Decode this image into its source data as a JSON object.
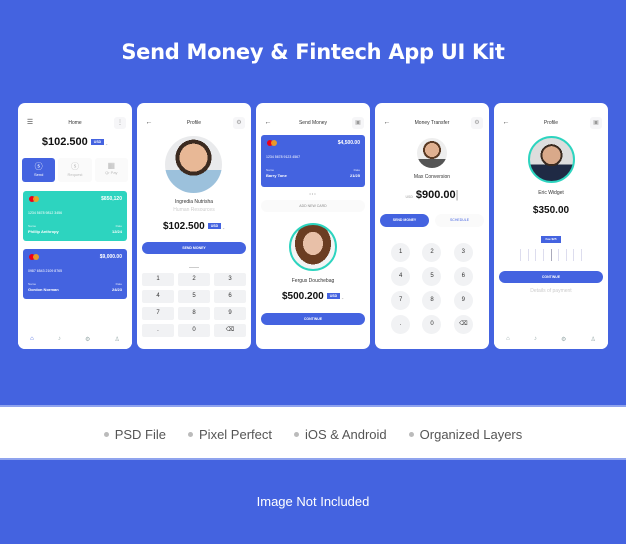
{
  "title": "Send Money & Fintech App UI Kit",
  "features": [
    "PSD File",
    "Pixel Perfect",
    "iOS & Android",
    "Organized Layers"
  ],
  "footer": "Image Not Included",
  "colors": {
    "brand": "#4463e0",
    "teal": "#2dd4bf",
    "bg": "#ffffff"
  },
  "screen1": {
    "header": "Home",
    "balance": "$102.500",
    "currency": "USD",
    "actions": [
      {
        "label": "Send",
        "icon": "dollar-icon"
      },
      {
        "label": "Request",
        "icon": "dollar-icon"
      },
      {
        "label": "Qr Pay",
        "icon": "qr-icon"
      }
    ],
    "cards": [
      {
        "amount": "$850,120",
        "number": "1234 5678 9812 3456",
        "name_label": "Name",
        "name": "Phillip Anthropy",
        "date_label": "Date",
        "date": "12/24"
      },
      {
        "amount": "$9,000.00",
        "number": "0987 6543 2109 8765",
        "name_label": "Name",
        "name": "Gordon Norman",
        "date_label": "Date",
        "date": "24/23"
      }
    ]
  },
  "screen2": {
    "header": "Profile",
    "name": "Ingredia Nutrisha",
    "role": "Human Resources",
    "balance": "$102.500",
    "currency": "USD",
    "button": "SEND MONEY",
    "keys": [
      "1",
      "2",
      "3",
      "4",
      "5",
      "6",
      "7",
      "8",
      "9",
      ".",
      "0",
      "⌫"
    ]
  },
  "screen3": {
    "header": "Send Money",
    "card": {
      "amount": "$4,500.00",
      "number": "1234 5678 9123 4567",
      "name_label": "Name",
      "name": "Barry Tone",
      "date_label": "Date",
      "date": "21/25"
    },
    "add_card": "ADD NEW CARD",
    "name": "Fergus Douchebag",
    "amount": "$500.200",
    "currency": "USD",
    "button": "CONTINUE"
  },
  "screen4": {
    "header": "Money Transfer",
    "name": "Max Conversion",
    "currency": "USD",
    "amount": "$900.00",
    "send_tab": "SEND MONEY",
    "schedule_tab": "SCHEDULE",
    "keys": [
      "1",
      "2",
      "3",
      "4",
      "5",
      "6",
      "7",
      "8",
      "9",
      ".",
      "0",
      "⌫"
    ]
  },
  "screen5": {
    "header": "Profile",
    "name": "Eric Widget",
    "amount": "$350.00",
    "fee": "Fee $25",
    "button": "CONTINUE",
    "details": "Details of payment"
  }
}
